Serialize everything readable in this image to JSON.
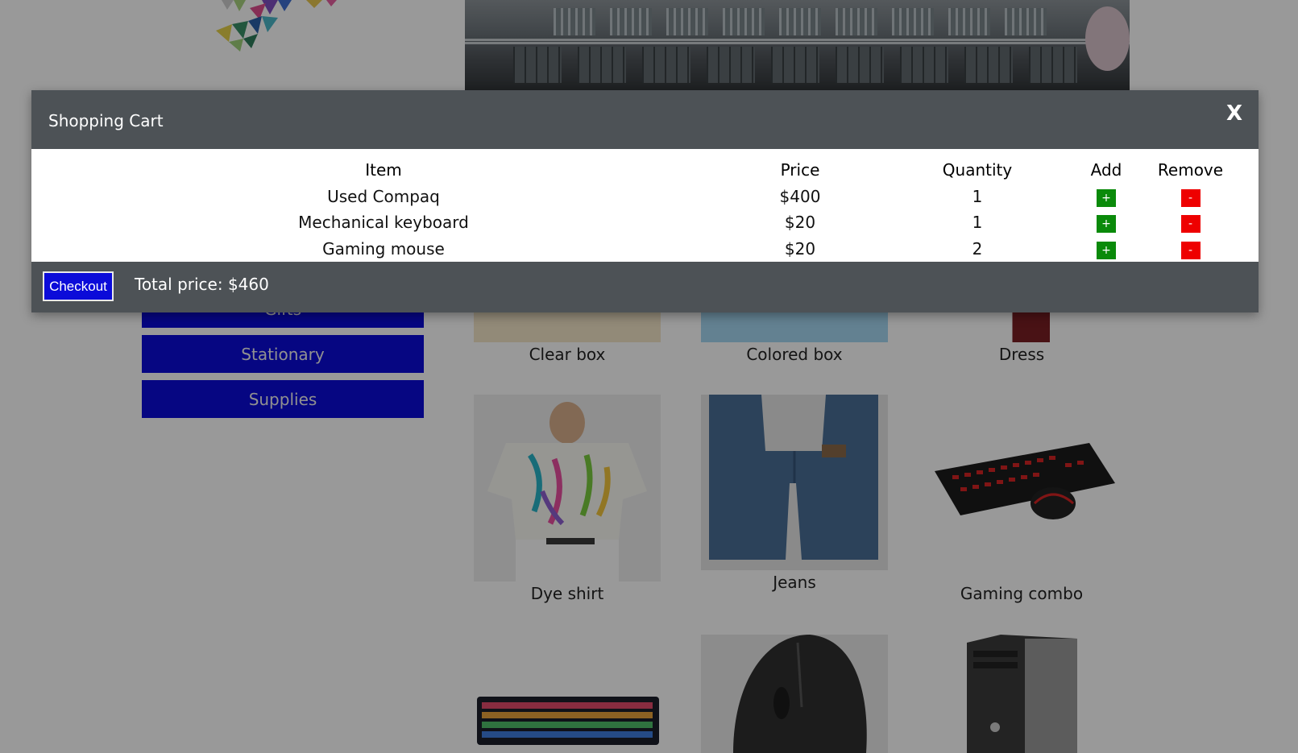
{
  "sidebar": {
    "items": [
      {
        "label": "Gifts"
      },
      {
        "label": "Stationary"
      },
      {
        "label": "Supplies"
      }
    ]
  },
  "products": [
    {
      "name": "Clear box"
    },
    {
      "name": "Colored box"
    },
    {
      "name": "Dress"
    },
    {
      "name": "Dye shirt"
    },
    {
      "name": "Jeans"
    },
    {
      "name": "Gaming combo"
    }
  ],
  "cart": {
    "title": "Shopping Cart",
    "close_label": "X",
    "columns": [
      "Item",
      "Price",
      "Quantity",
      "Add",
      "Remove"
    ],
    "rows": [
      {
        "item": "Used Compaq",
        "price": "$400",
        "quantity": "1"
      },
      {
        "item": "Mechanical keyboard",
        "price": "$20",
        "quantity": "1"
      },
      {
        "item": "Gaming mouse",
        "price": "$20",
        "quantity": "2"
      }
    ],
    "add_label": "+",
    "remove_label": "-",
    "checkout_label": "Checkout",
    "total_text": "Total price: $460"
  },
  "colors": {
    "accent": "#0b0bd9",
    "modal_bar": "#4d5256",
    "add": "#0a8a0a",
    "remove": "#ee0000"
  },
  "icons": {
    "logo": "geometric-cubes-logo",
    "banner": "campus-building-photo"
  }
}
